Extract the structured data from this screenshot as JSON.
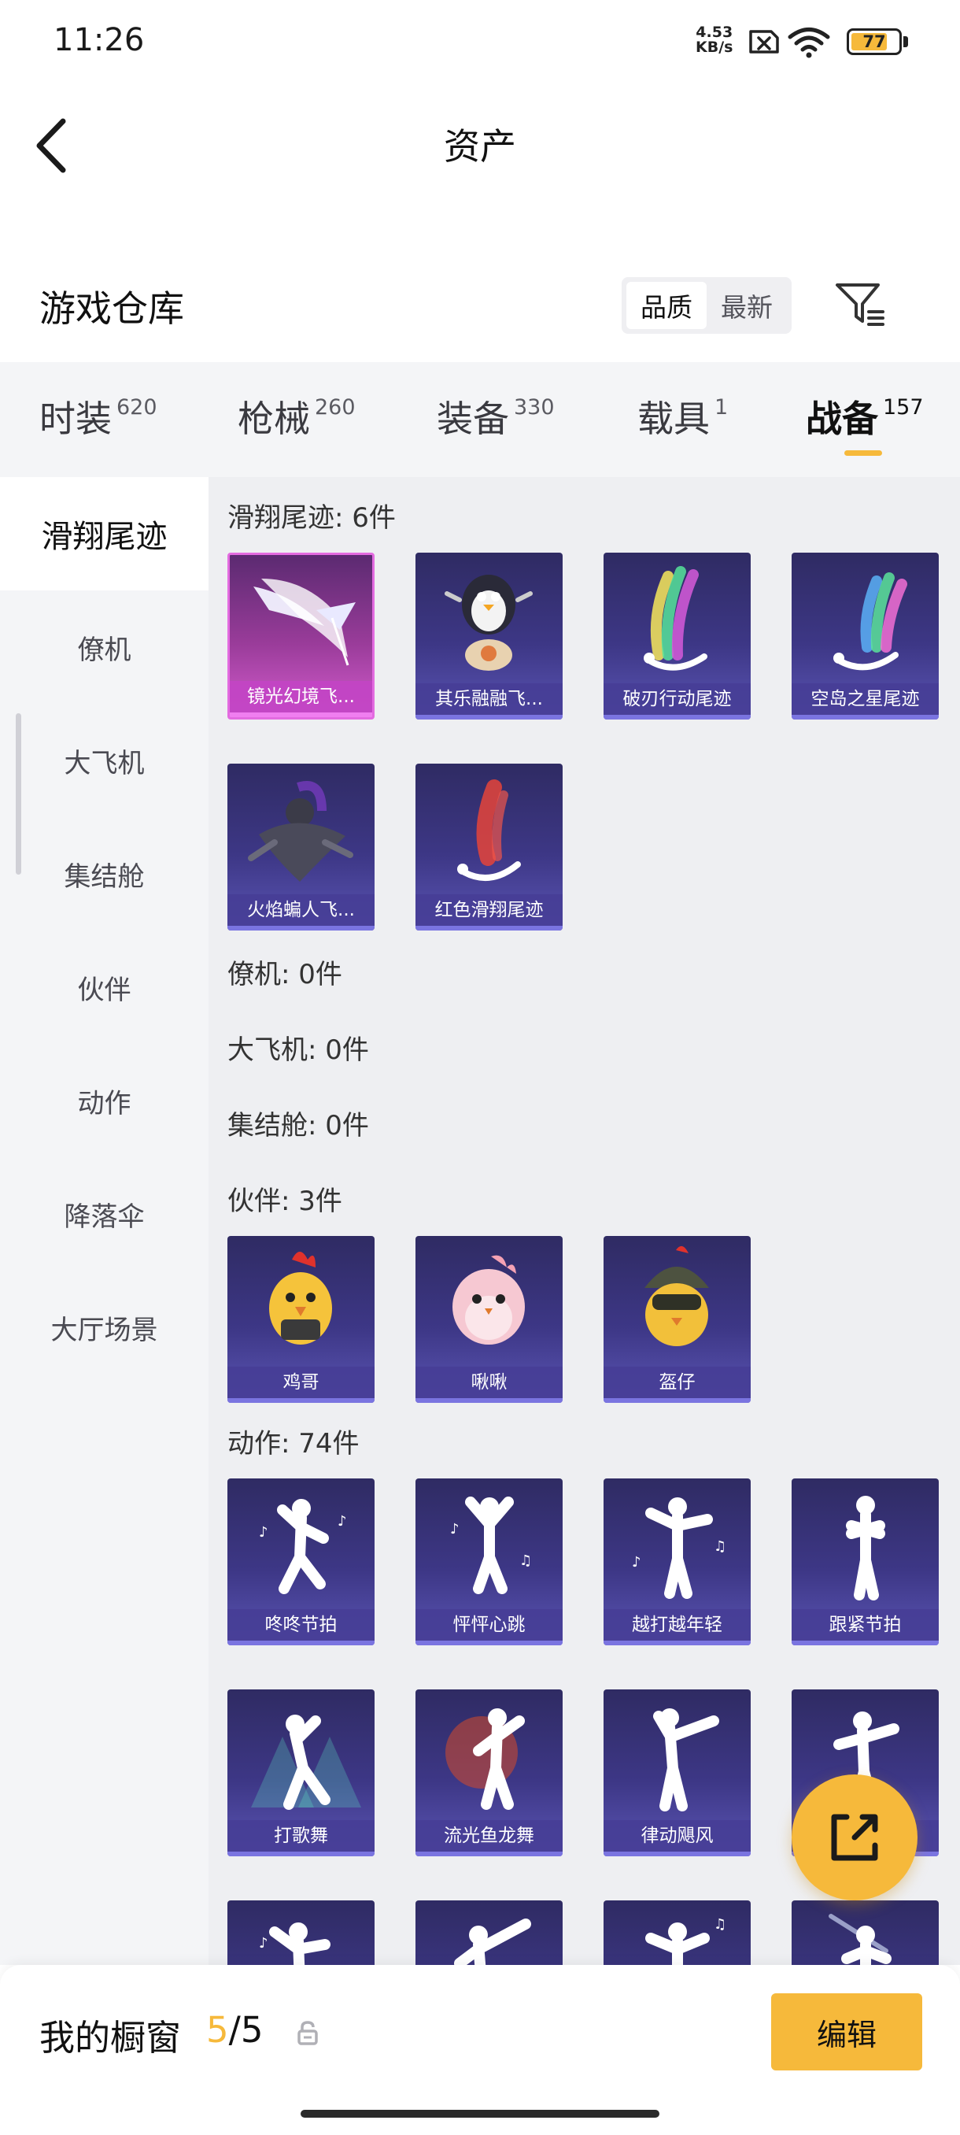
{
  "status_bar": {
    "time": "11:26",
    "net_speed_value": "4.53",
    "net_speed_unit": "KB/s",
    "battery": "77",
    "battery_level": 0.77
  },
  "header": {
    "title": "资产"
  },
  "warehouse": {
    "title": "游戏仓库",
    "sort_options": [
      "品质",
      "最新"
    ],
    "sort_selected": "品质"
  },
  "tabs": [
    {
      "label": "时装",
      "count": "620"
    },
    {
      "label": "枪械",
      "count": "260"
    },
    {
      "label": "装备",
      "count": "330"
    },
    {
      "label": "载具",
      "count": "1"
    },
    {
      "label": "战备",
      "count": "157",
      "active": true
    }
  ],
  "sidebar": {
    "items": [
      "滑翔尾迹",
      "僚机",
      "大飞机",
      "集结舱",
      "伙伴",
      "动作",
      "降落伞",
      "大厅场景"
    ],
    "active": "滑翔尾迹"
  },
  "sections": [
    {
      "title": "滑翔尾迹: 6件",
      "items": [
        {
          "label": "镜光幻境飞...",
          "icon": "wings-icon"
        },
        {
          "label": "其乐融融飞...",
          "icon": "penguin-balloon-icon"
        },
        {
          "label": "破刃行动尾迹",
          "icon": "rainbow-smoke-trail-icon"
        },
        {
          "label": "空岛之星尾迹",
          "icon": "rainbow-smoke-trail-icon"
        },
        {
          "label": "火焰蝙人飞...",
          "icon": "bat-character-icon"
        },
        {
          "label": "红色滑翔尾迹",
          "icon": "red-smoke-trail-icon"
        }
      ]
    },
    {
      "title": "僚机: 0件",
      "items": []
    },
    {
      "title": "大飞机: 0件",
      "items": []
    },
    {
      "title": "集结舱: 0件",
      "items": []
    },
    {
      "title": "伙伴: 3件",
      "items": [
        {
          "label": "鸡哥",
          "icon": "chicken-icon"
        },
        {
          "label": "啾啾",
          "icon": "pink-bird-icon"
        },
        {
          "label": "盔仔",
          "icon": "helmet-chick-icon"
        }
      ]
    },
    {
      "title": "动作: 74件",
      "items": [
        {
          "label": "咚咚节拍",
          "icon": "dance-pose-icon"
        },
        {
          "label": "怦怦心跳",
          "icon": "dance-pose-icon"
        },
        {
          "label": "越打越年轻",
          "icon": "dance-pose-icon"
        },
        {
          "label": "跟紧节拍",
          "icon": "dance-pose-icon"
        },
        {
          "label": "打歌舞",
          "icon": "dance-pose-icon"
        },
        {
          "label": "流光鱼龙舞",
          "icon": "dance-pose-icon"
        },
        {
          "label": "律动飓风",
          "icon": "dance-pose-icon"
        },
        {
          "label": "",
          "icon": "dance-pose-icon"
        },
        {
          "label": "",
          "icon": "dance-pose-icon"
        },
        {
          "label": "",
          "icon": "dance-pose-icon"
        },
        {
          "label": "",
          "icon": "dance-pose-icon"
        },
        {
          "label": "",
          "icon": "dance-pose-icon"
        }
      ]
    }
  ],
  "bottom_bar": {
    "title": "我的橱窗",
    "current": "5",
    "separator": "/",
    "total": "5",
    "edit_label": "编辑"
  },
  "colors": {
    "accent": "#f6b93b",
    "card_purple": "#3d3786",
    "card_pink": "#c244c4"
  }
}
